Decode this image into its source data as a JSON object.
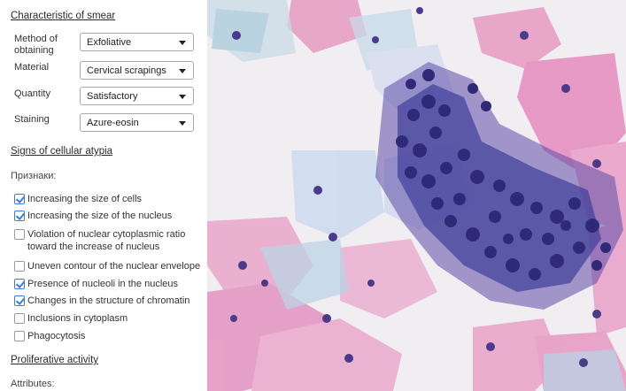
{
  "smear": {
    "title": "Characteristic of smear",
    "fields": [
      {
        "label": "Method of obtaining",
        "value": "Exfoliative"
      },
      {
        "label": "Material",
        "value": "Cervical scrapings"
      },
      {
        "label": "Quantity",
        "value": "Satisfactory"
      },
      {
        "label": "Staining",
        "value": "Azure-eosin"
      }
    ]
  },
  "atypia": {
    "title": "Signs of cellular atypia",
    "sub_label": "Признаки:",
    "items": [
      {
        "label": "Increasing the size of cells",
        "checked": true
      },
      {
        "label": "Increasing the size of the nucleus",
        "checked": true
      },
      {
        "label": "Violation of nuclear cytoplasmic ratio toward the increase of nucleus",
        "checked": false
      },
      {
        "label": "Uneven contour of the nuclear envelope",
        "checked": false
      },
      {
        "label": "Presence of nucleoli in the nucleus",
        "checked": true
      },
      {
        "label": "Changes in the structure of chromatin",
        "checked": true
      },
      {
        "label": "Inclusions in cytoplasm",
        "checked": false
      },
      {
        "label": "Phagocytosis",
        "checked": false
      }
    ]
  },
  "proliferative": {
    "title": "Proliferative activity",
    "sub_label": "Attributes:"
  },
  "colors": {
    "checkbox_accent": "#3a7fd6",
    "stain_pink": "#e79ac3",
    "stain_blue": "#3f3f9a",
    "stain_teal": "#9cc6d6"
  }
}
